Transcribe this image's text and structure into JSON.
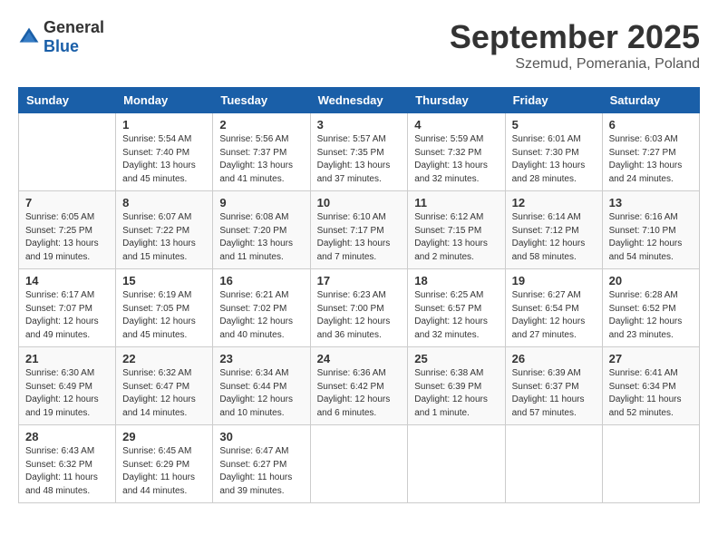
{
  "logo": {
    "general": "General",
    "blue": "Blue"
  },
  "header": {
    "month": "September 2025",
    "location": "Szemud, Pomerania, Poland"
  },
  "weekdays": [
    "Sunday",
    "Monday",
    "Tuesday",
    "Wednesday",
    "Thursday",
    "Friday",
    "Saturday"
  ],
  "weeks": [
    [
      {
        "day": "",
        "info": ""
      },
      {
        "day": "1",
        "info": "Sunrise: 5:54 AM\nSunset: 7:40 PM\nDaylight: 13 hours\nand 45 minutes."
      },
      {
        "day": "2",
        "info": "Sunrise: 5:56 AM\nSunset: 7:37 PM\nDaylight: 13 hours\nand 41 minutes."
      },
      {
        "day": "3",
        "info": "Sunrise: 5:57 AM\nSunset: 7:35 PM\nDaylight: 13 hours\nand 37 minutes."
      },
      {
        "day": "4",
        "info": "Sunrise: 5:59 AM\nSunset: 7:32 PM\nDaylight: 13 hours\nand 32 minutes."
      },
      {
        "day": "5",
        "info": "Sunrise: 6:01 AM\nSunset: 7:30 PM\nDaylight: 13 hours\nand 28 minutes."
      },
      {
        "day": "6",
        "info": "Sunrise: 6:03 AM\nSunset: 7:27 PM\nDaylight: 13 hours\nand 24 minutes."
      }
    ],
    [
      {
        "day": "7",
        "info": "Sunrise: 6:05 AM\nSunset: 7:25 PM\nDaylight: 13 hours\nand 19 minutes."
      },
      {
        "day": "8",
        "info": "Sunrise: 6:07 AM\nSunset: 7:22 PM\nDaylight: 13 hours\nand 15 minutes."
      },
      {
        "day": "9",
        "info": "Sunrise: 6:08 AM\nSunset: 7:20 PM\nDaylight: 13 hours\nand 11 minutes."
      },
      {
        "day": "10",
        "info": "Sunrise: 6:10 AM\nSunset: 7:17 PM\nDaylight: 13 hours\nand 7 minutes."
      },
      {
        "day": "11",
        "info": "Sunrise: 6:12 AM\nSunset: 7:15 PM\nDaylight: 13 hours\nand 2 minutes."
      },
      {
        "day": "12",
        "info": "Sunrise: 6:14 AM\nSunset: 7:12 PM\nDaylight: 12 hours\nand 58 minutes."
      },
      {
        "day": "13",
        "info": "Sunrise: 6:16 AM\nSunset: 7:10 PM\nDaylight: 12 hours\nand 54 minutes."
      }
    ],
    [
      {
        "day": "14",
        "info": "Sunrise: 6:17 AM\nSunset: 7:07 PM\nDaylight: 12 hours\nand 49 minutes."
      },
      {
        "day": "15",
        "info": "Sunrise: 6:19 AM\nSunset: 7:05 PM\nDaylight: 12 hours\nand 45 minutes."
      },
      {
        "day": "16",
        "info": "Sunrise: 6:21 AM\nSunset: 7:02 PM\nDaylight: 12 hours\nand 40 minutes."
      },
      {
        "day": "17",
        "info": "Sunrise: 6:23 AM\nSunset: 7:00 PM\nDaylight: 12 hours\nand 36 minutes."
      },
      {
        "day": "18",
        "info": "Sunrise: 6:25 AM\nSunset: 6:57 PM\nDaylight: 12 hours\nand 32 minutes."
      },
      {
        "day": "19",
        "info": "Sunrise: 6:27 AM\nSunset: 6:54 PM\nDaylight: 12 hours\nand 27 minutes."
      },
      {
        "day": "20",
        "info": "Sunrise: 6:28 AM\nSunset: 6:52 PM\nDaylight: 12 hours\nand 23 minutes."
      }
    ],
    [
      {
        "day": "21",
        "info": "Sunrise: 6:30 AM\nSunset: 6:49 PM\nDaylight: 12 hours\nand 19 minutes."
      },
      {
        "day": "22",
        "info": "Sunrise: 6:32 AM\nSunset: 6:47 PM\nDaylight: 12 hours\nand 14 minutes."
      },
      {
        "day": "23",
        "info": "Sunrise: 6:34 AM\nSunset: 6:44 PM\nDaylight: 12 hours\nand 10 minutes."
      },
      {
        "day": "24",
        "info": "Sunrise: 6:36 AM\nSunset: 6:42 PM\nDaylight: 12 hours\nand 6 minutes."
      },
      {
        "day": "25",
        "info": "Sunrise: 6:38 AM\nSunset: 6:39 PM\nDaylight: 12 hours\nand 1 minute."
      },
      {
        "day": "26",
        "info": "Sunrise: 6:39 AM\nSunset: 6:37 PM\nDaylight: 11 hours\nand 57 minutes."
      },
      {
        "day": "27",
        "info": "Sunrise: 6:41 AM\nSunset: 6:34 PM\nDaylight: 11 hours\nand 52 minutes."
      }
    ],
    [
      {
        "day": "28",
        "info": "Sunrise: 6:43 AM\nSunset: 6:32 PM\nDaylight: 11 hours\nand 48 minutes."
      },
      {
        "day": "29",
        "info": "Sunrise: 6:45 AM\nSunset: 6:29 PM\nDaylight: 11 hours\nand 44 minutes."
      },
      {
        "day": "30",
        "info": "Sunrise: 6:47 AM\nSunset: 6:27 PM\nDaylight: 11 hours\nand 39 minutes."
      },
      {
        "day": "",
        "info": ""
      },
      {
        "day": "",
        "info": ""
      },
      {
        "day": "",
        "info": ""
      },
      {
        "day": "",
        "info": ""
      }
    ]
  ]
}
